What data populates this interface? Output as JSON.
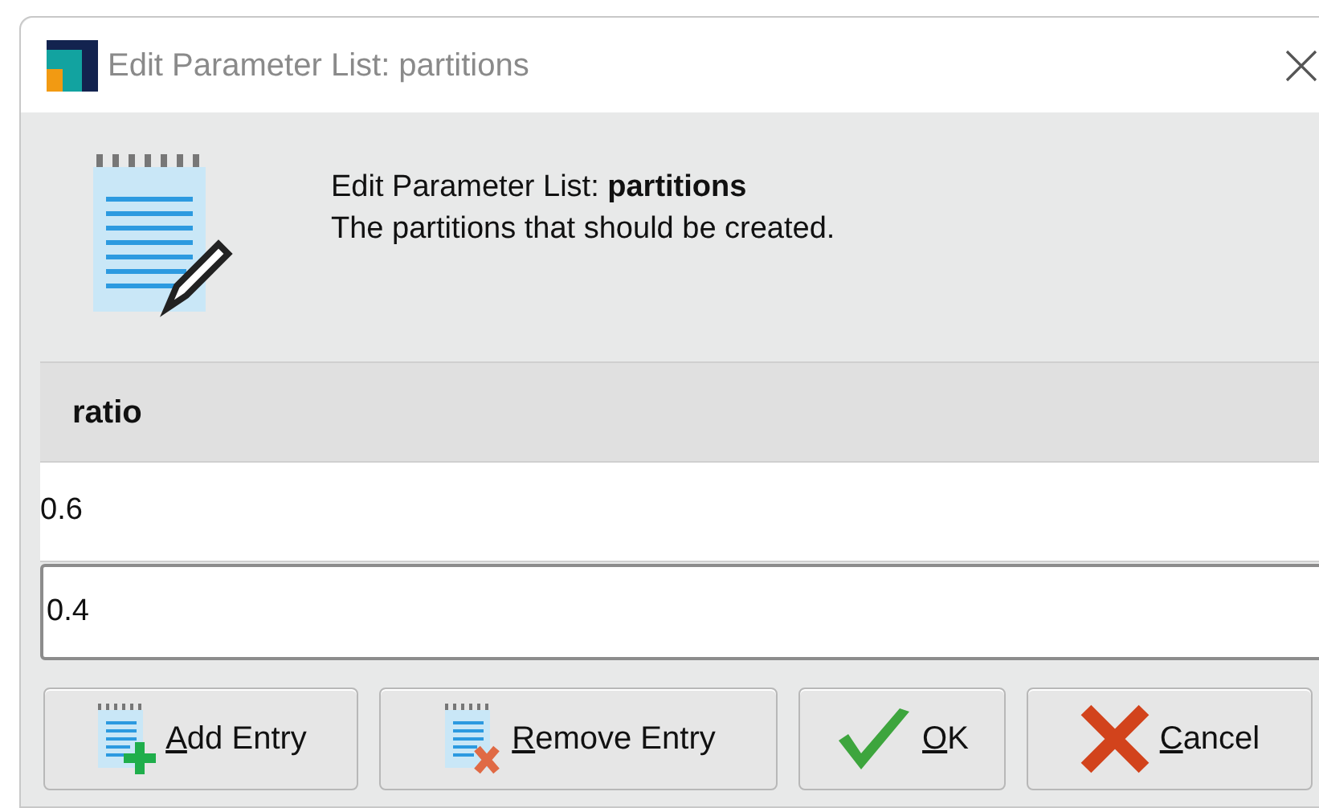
{
  "window": {
    "title": "Edit Parameter List: partitions"
  },
  "header": {
    "heading": "Edit Parameter List: **partitions**",
    "description": "The partitions that should be created."
  },
  "table": {
    "columns": [
      "ratio"
    ],
    "rows": [
      {
        "kind": "cell",
        "value": "0.6"
      },
      {
        "kind": "editor",
        "value": "0.4"
      }
    ]
  },
  "buttons": [
    {
      "kind": "add",
      "mnemonic": "A",
      "rest": "dd Entry"
    },
    {
      "kind": "remove",
      "mnemonic": "R",
      "rest": "emove Entry"
    },
    {
      "kind": "ok",
      "mnemonic": "O",
      "rest": "K"
    },
    {
      "kind": "cancel",
      "mnemonic": "C",
      "rest": "ancel"
    }
  ]
}
